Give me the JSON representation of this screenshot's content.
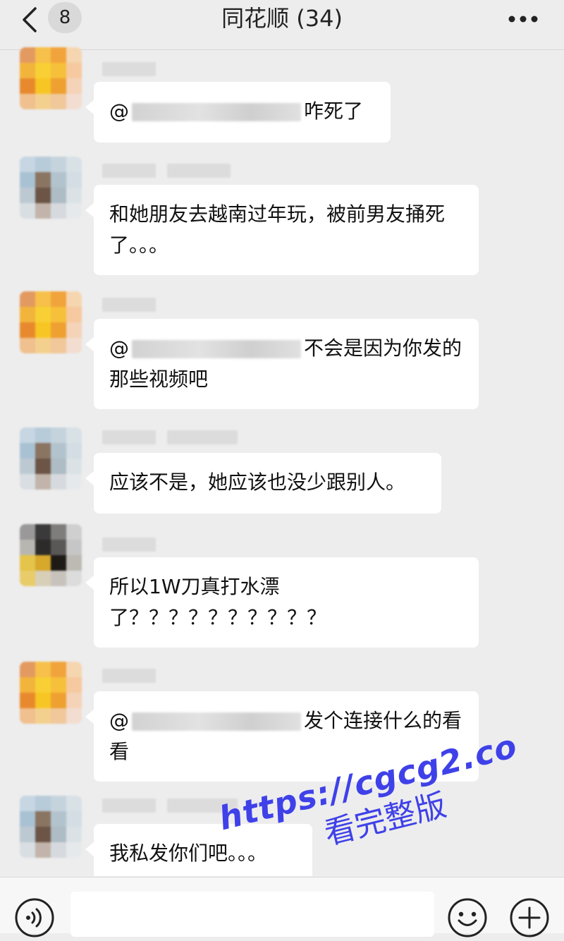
{
  "header": {
    "unread_count": "8",
    "title": "同花顺 (34)"
  },
  "messages": [
    {
      "prefix": "@",
      "text": "咋死了"
    },
    {
      "text": "和她朋友去越南过年玩，被前男友捅死了。。。"
    },
    {
      "prefix": "@",
      "text": "不会是因为你发的那些视频吧"
    },
    {
      "text": "应该不是，她应该也没少跟别人。"
    },
    {
      "text": "所以1W刀真打水漂了？？？？？？？？？？"
    },
    {
      "prefix": "@",
      "text": "发个连接什么的看看"
    },
    {
      "text": "我私发你们吧。。。"
    }
  ],
  "watermark": {
    "url": "https://cgcg2.co",
    "caption": "看完整版"
  },
  "colors": {
    "background": "#ededed",
    "bubble": "#ffffff",
    "watermark": "#3f41e8"
  },
  "icons": {
    "back": "chevron-left-icon",
    "more": "more-horizontal-icon",
    "voice": "voice-icon",
    "emoji": "emoji-icon",
    "plus": "plus-icon"
  }
}
